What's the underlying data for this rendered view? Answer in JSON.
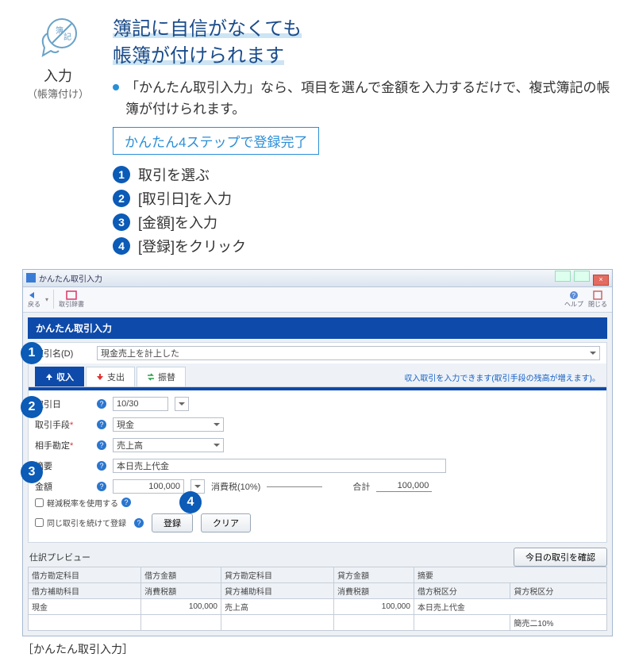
{
  "promo": {
    "icon_label": "入力",
    "icon_sub": "（帳簿付け）",
    "headline_l1a": "簿記に自信がなくても",
    "headline_l2a": "帳簿が付けられます",
    "desc": "「かんたん取引入力」なら、項目を選んで金額を入力するだけで、複式簿記の帳簿が付けられます。",
    "steps_title": "かんたん4ステップで登録完了",
    "steps": [
      "取引を選ぶ",
      "[取引日]を入力",
      "[金額]を入力",
      "[登録]をクリック"
    ]
  },
  "win": {
    "title": "かんたん取引入力",
    "toolbar": {
      "back": "戻る",
      "journal": "取引辞書",
      "help": "ヘルプ",
      "close": "閉じる"
    }
  },
  "form": {
    "section_title": "かんたん取引入力",
    "name_label": "取引名(D)",
    "name_value": "現金売上を計上した",
    "tabs": {
      "income": "収入",
      "expense": "支出",
      "transfer": "振替"
    },
    "tabs_note": "収入取引を入力できます(取引手段の残高が増えます)。",
    "date_label": "取引日",
    "date_value": "10/30",
    "method_label": "取引手段",
    "method_value": "現金",
    "counter_label": "相手勘定",
    "counter_value": "売上高",
    "memo_label": "摘要",
    "memo_value": "本日売上代金",
    "amount_label": "金額",
    "amount_value": "100,000",
    "tax_label": "消費税(10%)",
    "total_label": "合計",
    "total_value": "100,000",
    "chk_reduced": "軽減税率を使用する",
    "chk_continue": "同じ取引を続けて登録",
    "register": "登録",
    "clear": "クリア",
    "today_btn": "今日の取引を確認"
  },
  "preview": {
    "title": "仕訳プレビュー",
    "headers": {
      "dr_acct": "借方勘定科目",
      "dr_amt": "借方金額",
      "cr_acct": "貸方勘定科目",
      "cr_amt": "貸方金額",
      "memo": "摘要",
      "dr_sub": "借方補助科目",
      "dr_tax": "消費税額",
      "cr_sub": "貸方補助科目",
      "cr_tax": "消費税額",
      "dr_taxcls": "借方税区分",
      "cr_taxcls": "貸方税区分"
    },
    "row": {
      "dr_acct": "現金",
      "dr_amt": "100,000",
      "cr_acct": "売上高",
      "cr_amt": "100,000",
      "memo": "本日売上代金",
      "cr_taxcls": "簡売二10%"
    }
  },
  "caption": "［かんたん取引入力］"
}
